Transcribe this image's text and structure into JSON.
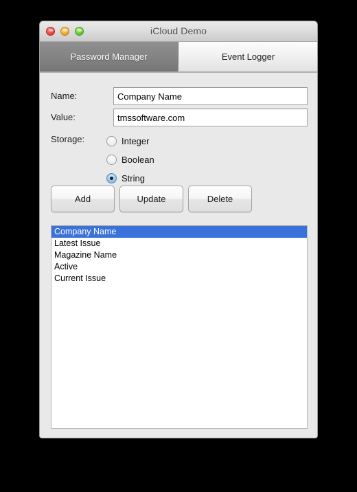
{
  "window": {
    "title": "iCloud Demo",
    "traffic_lights": [
      {
        "name": "close-button",
        "color": "#f2514b"
      },
      {
        "name": "minimize-button",
        "color": "#f5b33c"
      },
      {
        "name": "zoom-button",
        "color": "#77cf44"
      }
    ]
  },
  "tabs": [
    {
      "label": "Password Manager",
      "active": true
    },
    {
      "label": "Event Logger",
      "active": false
    }
  ],
  "form": {
    "name": {
      "label": "Name:",
      "value": "Company Name",
      "placeholder": ""
    },
    "value": {
      "label": "Value:",
      "value": "tmssoftware.com",
      "placeholder": ""
    },
    "storage": {
      "label": "Storage:",
      "options": [
        {
          "label": "Integer",
          "selected": false
        },
        {
          "label": "Boolean",
          "selected": false
        },
        {
          "label": "String",
          "selected": true
        }
      ]
    }
  },
  "buttons": {
    "add": "Add",
    "update": "Update",
    "delete": "Delete"
  },
  "list": {
    "items": [
      {
        "label": "Company Name",
        "selected": true
      },
      {
        "label": "Latest Issue",
        "selected": false
      },
      {
        "label": "Magazine Name",
        "selected": false
      },
      {
        "label": "Active",
        "selected": false
      },
      {
        "label": "Current Issue",
        "selected": false
      }
    ]
  },
  "colors": {
    "selection_blue": "#3b72d9",
    "active_tab_gray": "#848484",
    "window_background": "#e9e9e9"
  }
}
